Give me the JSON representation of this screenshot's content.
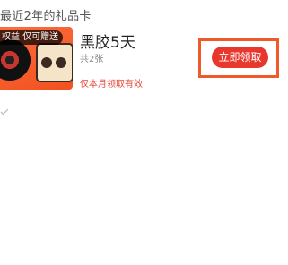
{
  "header": {
    "title": "最近2年的礼品卡"
  },
  "card": {
    "title": "黑胶5天",
    "count": "共2张",
    "note": "仅本月领取有效",
    "badge": "权益 仅可赠送",
    "claim_label": "立即领取",
    "thumbnail_icon": "vinyl-radio-illustration"
  },
  "colors": {
    "accent": "#e8372d",
    "highlight_outline": "#f05a2a",
    "thumbnail_bg": "#f0521f"
  }
}
